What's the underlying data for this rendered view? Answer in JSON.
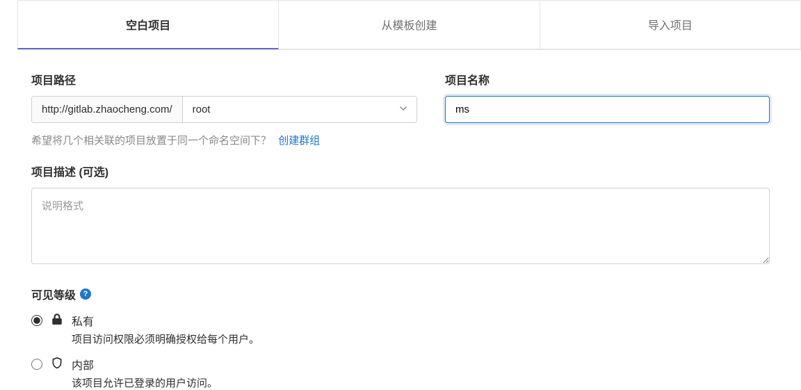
{
  "tabs": {
    "blank": "空白项目",
    "template": "从模板创建",
    "import": "导入项目"
  },
  "projectPath": {
    "label": "项目路径",
    "prefix": "http://gitlab.zhaocheng.com/",
    "selected": "root"
  },
  "projectName": {
    "label": "项目名称",
    "value": "ms"
  },
  "hint": {
    "text": "希望将几个相关联的项目放置于同一个命名空间下？",
    "link": "创建群组"
  },
  "description": {
    "label": "项目描述 (可选)",
    "placeholder": "说明格式"
  },
  "visibility": {
    "title": "可见等级",
    "options": [
      {
        "name": "私有",
        "desc": "项目访问权限必须明确授权给每个用户。"
      },
      {
        "name": "内部",
        "desc": "该项目允许已登录的用户访问。"
      }
    ]
  }
}
